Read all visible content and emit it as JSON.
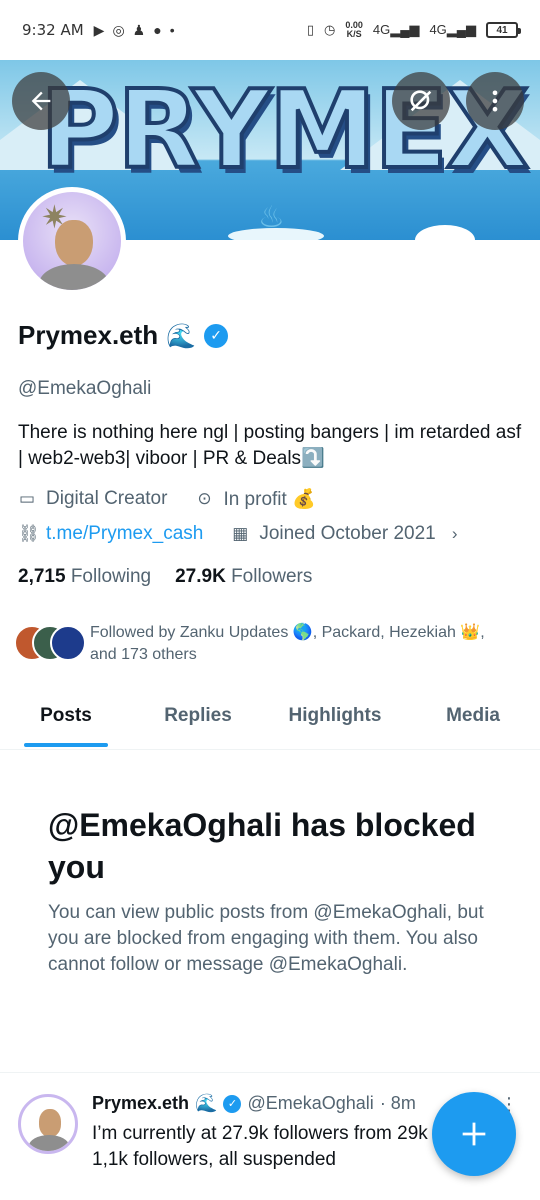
{
  "status_bar": {
    "time": "9:32 AM",
    "net_speed_top": "0.00",
    "net_speed_bottom": "K/S",
    "net_type_1": "4G",
    "net_type_2": "4G",
    "battery": "41"
  },
  "banner": {
    "text": "PRYMEX"
  },
  "profile": {
    "name": "Prymex.eth",
    "name_emoji": "🌊",
    "handle": "@EmekaOghali",
    "bio": "There is nothing here ngl | posting bangers | im retarded asf | web2-web3| viboor | PR & Deals⤵️",
    "category": "Digital Creator",
    "location": "In profit 💰",
    "website": "t.me/Prymex_cash",
    "joined": "Joined October 2021",
    "following_count": "2,715",
    "following_label": "Following",
    "followers_count": "27.9K",
    "followers_label": "Followers",
    "followed_by": "Followed by Zanku Updates 🌎, Packard, Hezekiah 👑, and 173 others"
  },
  "tabs": [
    "Posts",
    "Replies",
    "Highlights",
    "Media"
  ],
  "blocked": {
    "title": "@EmekaOghali has blocked you",
    "text": "You can view public posts from @EmekaOghali, but you are blocked from engaging with them. You also cannot follow or message @EmekaOghali."
  },
  "tweet": {
    "name": "Prymex.eth",
    "emoji": "🌊",
    "handle": "@EmekaOghali",
    "time": "· 8m",
    "text": "I’m currently at 27.9k followers from 29k 1,1k followers, all suspended"
  },
  "colors": {
    "accent": "#1d9bf0",
    "secondary_text": "#536471"
  }
}
